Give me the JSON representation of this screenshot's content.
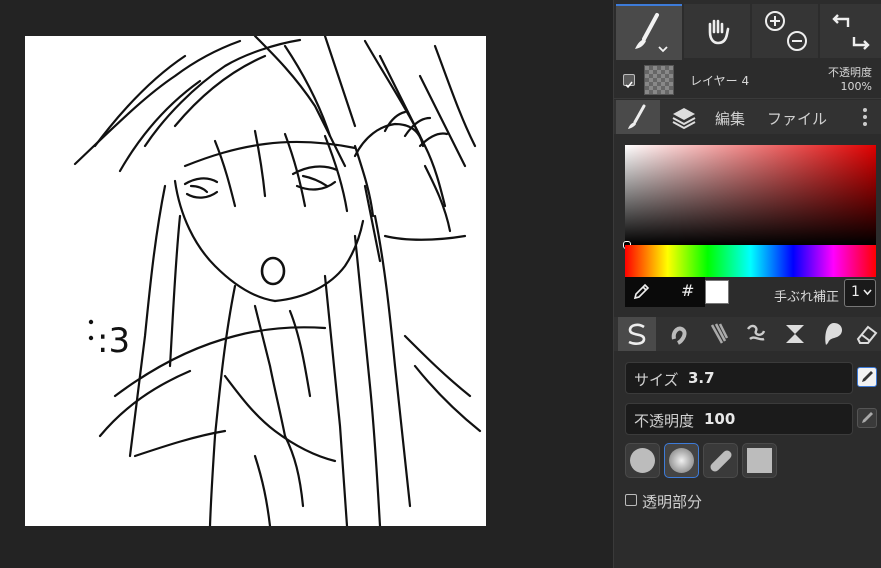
{
  "toolbar": {
    "tools": [
      {
        "name": "brush-tool",
        "icon": "brush-icon",
        "active": true
      },
      {
        "name": "hand-tool",
        "icon": "hand-icon",
        "active": false
      },
      {
        "name": "zoom-tool",
        "icon": "zoom-in-out-icon",
        "active": false
      },
      {
        "name": "undo-redo",
        "icon": "undo-redo-icon",
        "active": false
      }
    ]
  },
  "layer": {
    "name": "レイヤー 4",
    "opacity_label": "不透明度",
    "opacity_value": "100%"
  },
  "panel_tabs": {
    "edit": "編集",
    "file": "ファイル"
  },
  "color": {
    "hex_symbol": "#",
    "current": "#ffffff",
    "stabilizer_label": "手ぶれ補正",
    "stabilizer_value": "1"
  },
  "brush": {
    "size_label": "サイズ",
    "size_value": "3.7",
    "opacity_label": "不透明度",
    "opacity_value": "100",
    "transparent_label": "透明部分"
  },
  "canvas": {
    "note": ":3"
  }
}
